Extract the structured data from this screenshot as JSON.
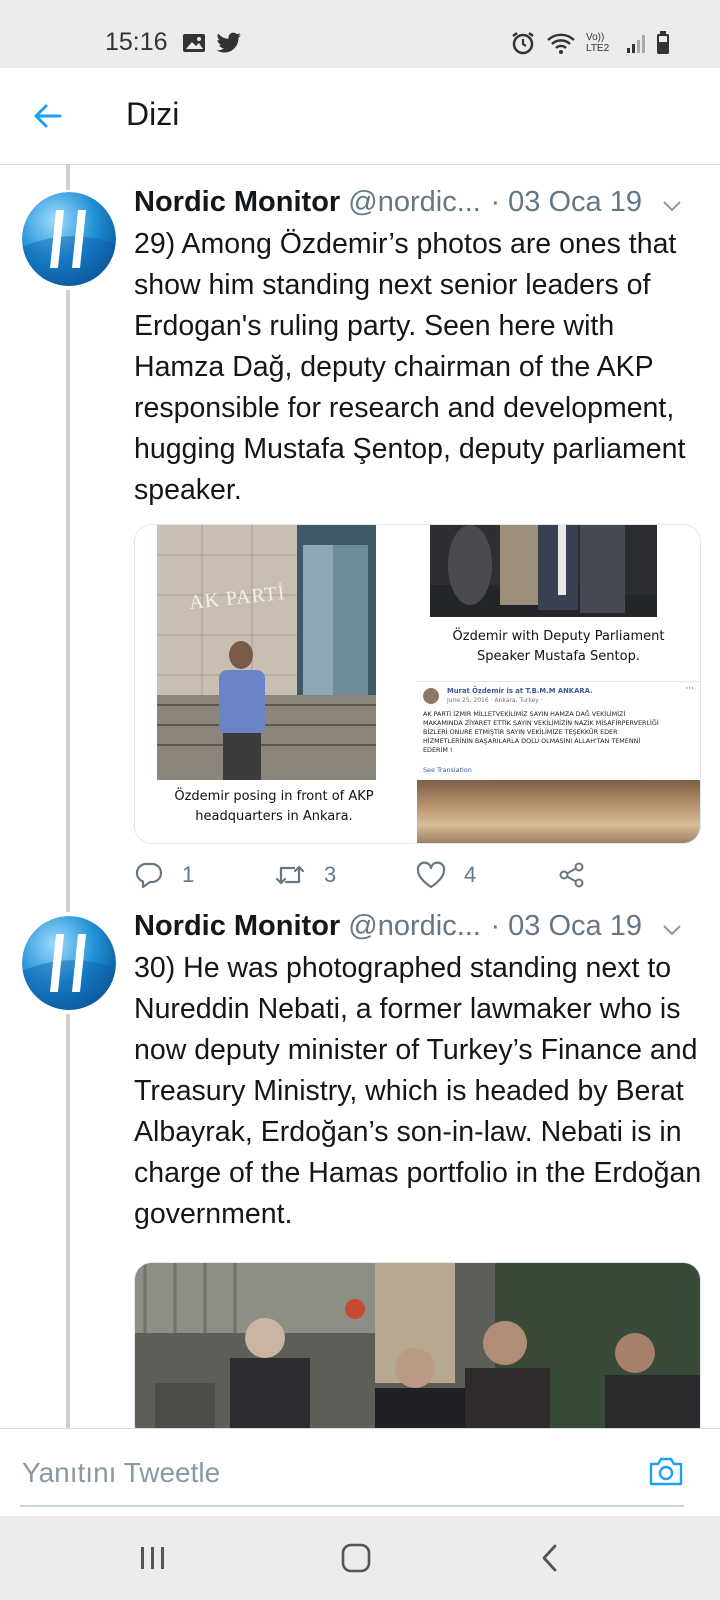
{
  "status_bar": {
    "time": "15:16",
    "network_label": "Vo)) LTE2",
    "icons_left": [
      "image-icon",
      "twitter-icon"
    ],
    "icons_right": [
      "alarm-icon",
      "wifi-icon",
      "signal-icon",
      "battery-icon"
    ]
  },
  "header": {
    "title": "Dizi",
    "back_icon": "arrow-left-icon"
  },
  "tweets": [
    {
      "name": "Nordic Monitor",
      "handle": "@nordic...",
      "date": "· 03 Oca 19",
      "text": "29) Among Özdemir’s photos are ones that show him standing next senior leaders of Erdogan's ruling party. Seen here with Hamza Dağ, deputy chairman of the AKP responsible for research and development, hugging Mustafa Şentop, deputy parliament speaker.",
      "media": {
        "photo1": {
          "sign": "AK PARTİ",
          "caption_line1": "Özdemir posing in front of AKP",
          "caption_line2": "headquarters in Ankara."
        },
        "photo2": {
          "caption_line1": "Özdemir with Deputy Parliament",
          "caption_line2": "Speaker Mustafa Sentop."
        },
        "photo3": {
          "author": "Murat Özdemir is at T.B.M.M ANKARA.",
          "meta": "June 25, 2016 · Ankara, Turkey ·",
          "post": "AK PARTİ İZMİR MİLLETVEKİLİMİZ SAYIN HAMZA DAĞ VEKİLİMİZİ MAKAMINDA ZİYARET ETTİK SAYIN VEKİLİMİZİN NAZİK MİSAFİRPERVERLİĞİ BİZLERİ ONURE ETMİŞTİR SAYIN VEKİLİMİZE TEŞEKKÜR EDER HİZMETLERİNİN BAŞARILARLA DOLU OLMASINI ALLAH'TAN TEMENNİ EDERİM !",
          "see_translation": "See Translation",
          "more": "···"
        }
      },
      "actions": {
        "replies": "1",
        "retweets": "3",
        "likes": "4"
      }
    },
    {
      "name": "Nordic Monitor",
      "handle": "@nordic...",
      "date": "· 03 Oca 19",
      "text": "30) He was photographed standing next to Nureddin Nebati, a former lawmaker who is now deputy minister of Turkey’s Finance and Treasury Ministry, which is headed by Berat Albayrak, Erdoğan’s son-in-law. Nebati is in charge of the Hamas portfolio in the Erdoğan government."
    }
  ],
  "reply_bar": {
    "placeholder": "Yanıtını Tweetle",
    "camera_icon": "camera-icon"
  },
  "nav_bar": {
    "icons": [
      "recent-apps-icon",
      "home-icon",
      "back-icon"
    ]
  },
  "colors": {
    "accent": "#1da1f2",
    "text": "#14171a",
    "muted": "#657786",
    "thread_line": "#c9d0d6"
  }
}
